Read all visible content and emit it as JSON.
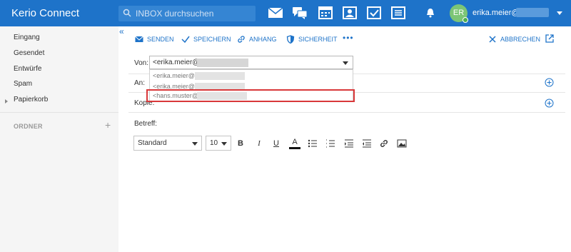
{
  "app": {
    "title": "Kerio Connect"
  },
  "search": {
    "placeholder": "INBOX durchsuchen"
  },
  "header": {
    "user_name": "erika.meier@",
    "avatar_initials": "ER",
    "apps": [
      "mail-icon",
      "chat-icon",
      "calendar-icon",
      "contacts-icon",
      "tasks-icon",
      "notes-icon"
    ],
    "accent_color": "#1e73c9"
  },
  "sidebar": {
    "items": [
      {
        "label": "Eingang"
      },
      {
        "label": "Gesendet"
      },
      {
        "label": "Entwürfe"
      },
      {
        "label": "Spam"
      },
      {
        "label": "Papierkorb"
      }
    ],
    "folders_label": "ORDNER"
  },
  "toolbar": {
    "send_label": "SENDEN",
    "save_label": "SPEICHERN",
    "attach_label": "ANHANG",
    "security_label": "SICHERHEIT",
    "more_label": "•••",
    "cancel_label": "ABBRECHEN"
  },
  "compose": {
    "from_label": "Von:",
    "from_value": "<erika.meier@",
    "to_label": "An:",
    "cc_label": "Kopie:",
    "subject_label": "Betreff:",
    "from_options": [
      "<erika.meier@",
      "<erika.meier@",
      "<hans.muster@"
    ],
    "highlight_color": "#d9383a"
  },
  "editor": {
    "font": "Standard",
    "size": "10",
    "bold": "B",
    "italic": "I",
    "underline": "U",
    "font_color": "A"
  }
}
